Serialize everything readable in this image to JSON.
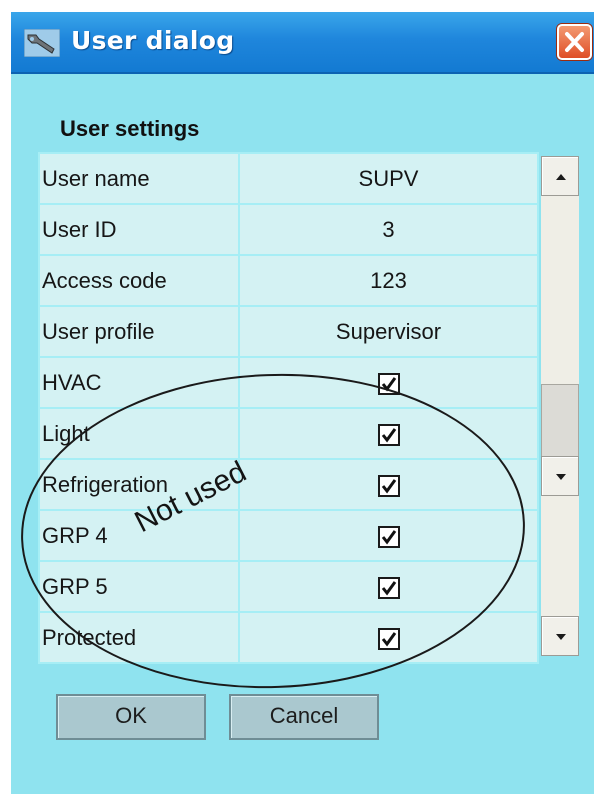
{
  "window": {
    "title": "User dialog",
    "icon": "wrench-icon",
    "close_icon": "close-x-icon",
    "accent": "#1f86dc",
    "background": "#8fe3ef"
  },
  "section": {
    "title": "User settings"
  },
  "settings": [
    {
      "label": "User name",
      "value": "SUPV"
    },
    {
      "label": "User ID",
      "value": "3"
    },
    {
      "label": "Access code",
      "value": "123"
    },
    {
      "label": "User profile",
      "value": "Supervisor"
    },
    {
      "label": "HVAC",
      "checked": true
    },
    {
      "label": "Light",
      "checked": true
    },
    {
      "label": "Refrigeration",
      "checked": true
    },
    {
      "label": "GRP 4",
      "checked": true
    },
    {
      "label": "GRP 5",
      "checked": true
    },
    {
      "label": "Protected",
      "checked": true
    }
  ],
  "buttons": {
    "ok": "OK",
    "cancel": "Cancel"
  },
  "annotation": {
    "text": "Not used"
  }
}
